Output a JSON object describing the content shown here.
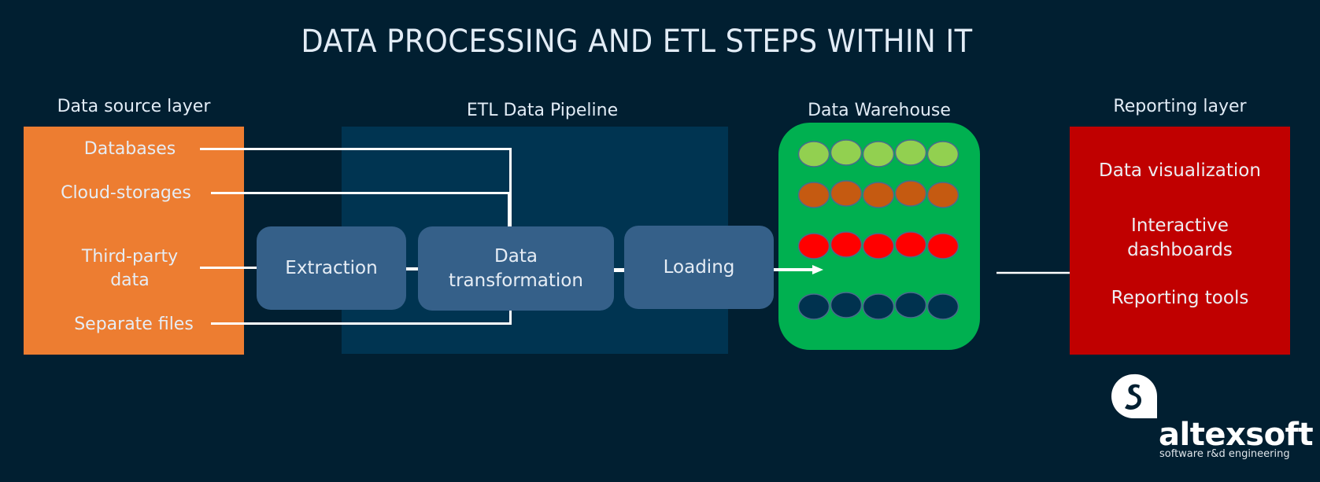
{
  "title": "DATA PROCESSING AND ETL STEPS WITHIN IT",
  "layers": {
    "source": {
      "label": "Data source layer",
      "items": [
        "Databases",
        "Cloud-storages",
        "Third-party data",
        "Separate files"
      ],
      "third_party_line1": "Third-party",
      "third_party_line2": "data",
      "color": "#ed7d31"
    },
    "pipeline": {
      "label": "ETL Data Pipeline",
      "steps": {
        "extraction": "Extraction",
        "transformation_line1": "Data",
        "transformation_line2": "transformation",
        "loading": "Loading"
      },
      "background_color": "#003451",
      "step_color": "#356089"
    },
    "warehouse": {
      "label": "Data Warehouse",
      "color": "#00b050",
      "rows": [
        {
          "color": "#92d050",
          "count": 5
        },
        {
          "color": "#c55a11",
          "count": 5
        },
        {
          "color": "#ff0000",
          "count": 5
        },
        {
          "color": "#00324f",
          "count": 5
        }
      ]
    },
    "reporting": {
      "label": "Reporting layer",
      "color": "#c00000",
      "item1": "Data visualization",
      "item2_line1": "Interactive",
      "item2_line2": "dashboards",
      "item3": "Reporting tools"
    }
  },
  "brand": {
    "name": "altexsoft",
    "tagline": "software r&d engineering",
    "logo_icon": "altexsoft-logo-icon"
  },
  "colors": {
    "background": "#011f31",
    "text": "#e2ecf6",
    "connector": "#ffffff"
  }
}
